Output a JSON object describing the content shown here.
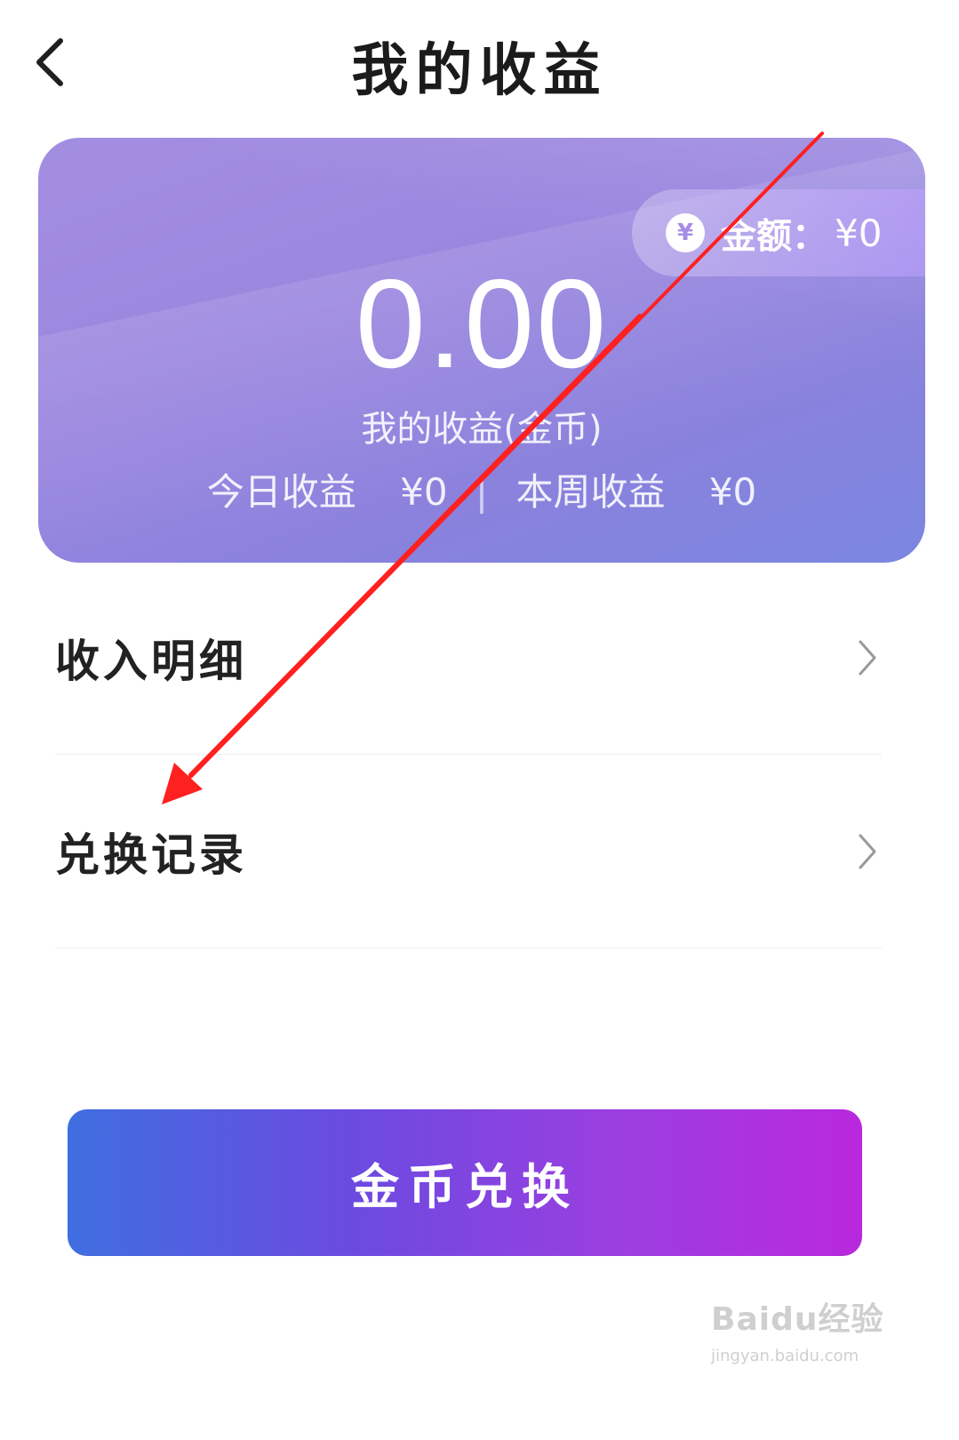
{
  "header": {
    "title": "我的收益"
  },
  "earnings_card": {
    "balance_label": "金额：",
    "balance_value": "¥0",
    "amount": "0.00",
    "amount_label": "我的收益(金币)",
    "today_label": "今日收益",
    "today_value": "¥0",
    "separator": "|",
    "week_label": "本周收益",
    "week_value": "¥0"
  },
  "menu": {
    "items": [
      {
        "label": "收入明细"
      },
      {
        "label": "兑换记录"
      }
    ]
  },
  "exchange_button": {
    "label": "金币兑换"
  },
  "watermark": {
    "logo": "Baidu经验",
    "url": "jingyan.baidu.com"
  },
  "colors": {
    "accent": "#7a4fe0",
    "annotation_arrow": "#ff2020"
  }
}
